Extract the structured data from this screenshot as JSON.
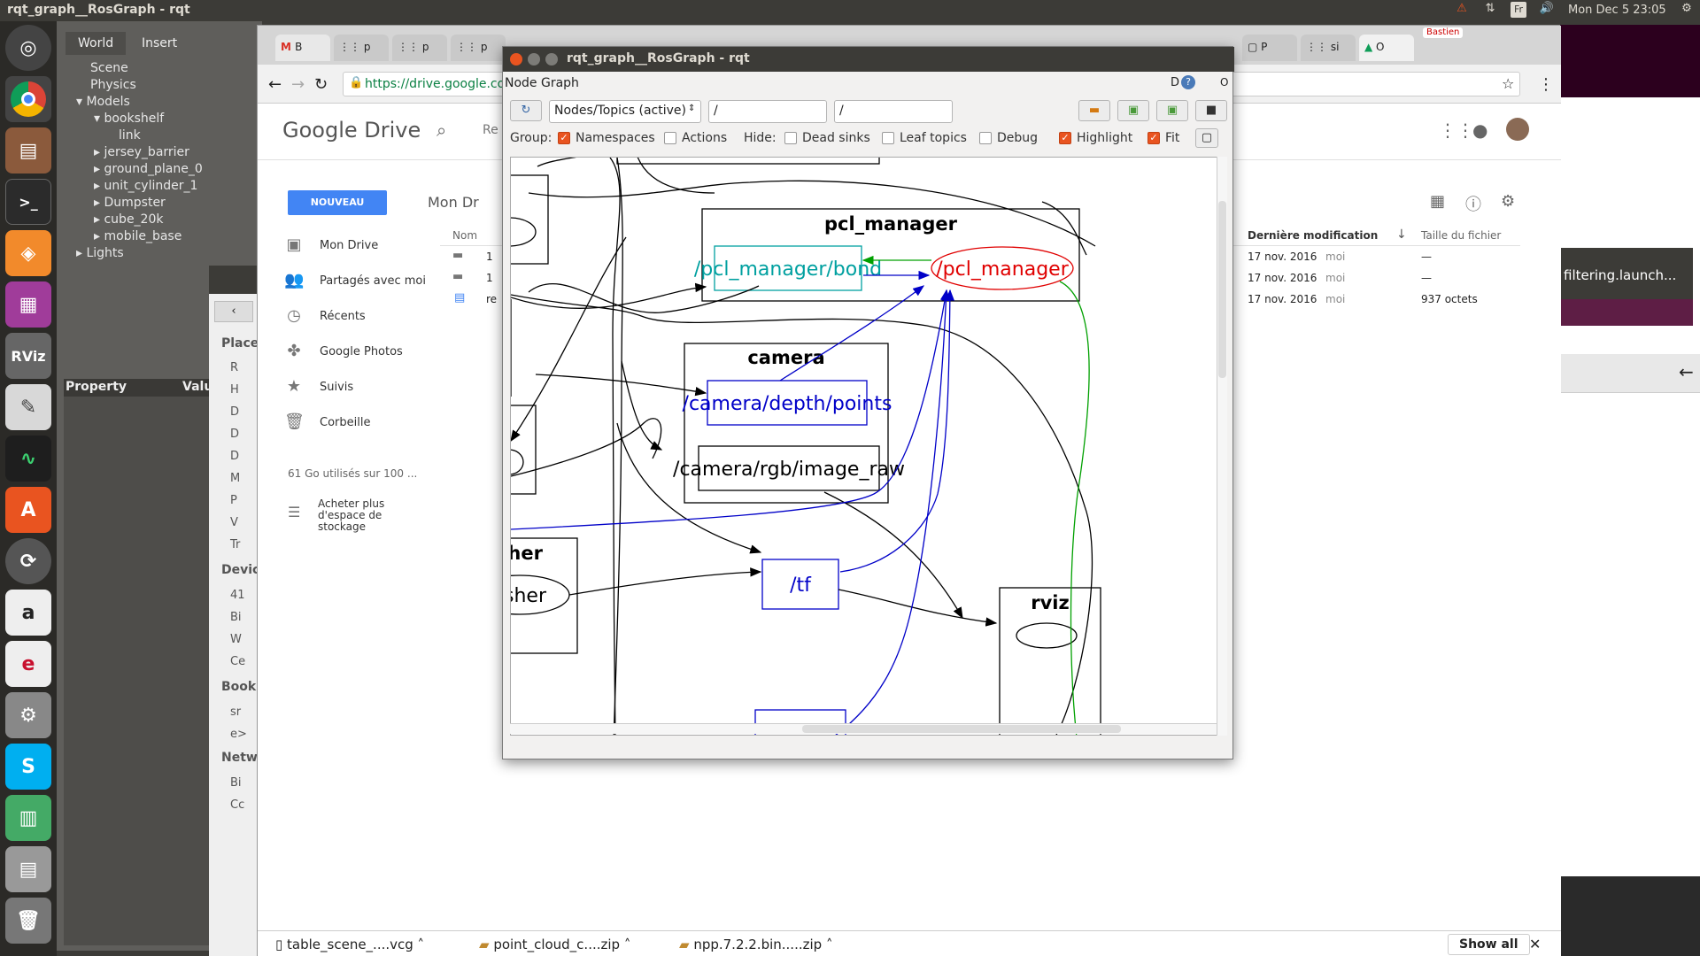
{
  "topbar": {
    "window_title": "rqt_graph__RosGraph - rqt",
    "keyboard_layout": "Fr",
    "clock": "Mon Dec  5 23:05"
  },
  "launcher": {
    "items": [
      "ubuntu-logo-icon",
      "chrome-icon",
      "files-icon",
      "terminal-icon",
      "sublime-icon",
      "rqt-icon",
      "rviz-icon",
      "text-editor-icon",
      "system-monitor-icon",
      "software-center-icon",
      "updater-icon",
      "amazon-icon",
      "app-icon",
      "settings-icon",
      "skype-icon",
      "stacked-apps-icon",
      "trash-icon"
    ],
    "rviz_label": "RViz"
  },
  "gazebo": {
    "tabs": [
      "World",
      "Insert"
    ],
    "tree": [
      {
        "label": "Scene",
        "level": 1
      },
      {
        "label": "Physics",
        "level": 1
      },
      {
        "label": "Models",
        "level": 0,
        "open": true
      },
      {
        "label": "bookshelf",
        "level": 1,
        "open": true
      },
      {
        "label": "link",
        "level": 3
      },
      {
        "label": "jersey_barrier",
        "level": 2
      },
      {
        "label": "ground_plane_0",
        "level": 2
      },
      {
        "label": "unit_cylinder_1",
        "level": 2
      },
      {
        "label": "Dumpster",
        "level": 2
      },
      {
        "label": "cube_20k",
        "level": 2
      },
      {
        "label": "mobile_base",
        "level": 2
      },
      {
        "label": "Lights",
        "level": 0
      }
    ],
    "property_header": "Property",
    "value_header": "Value"
  },
  "filemanager": {
    "section_places": "Place",
    "items_places": [
      "R",
      "H",
      "D",
      "D",
      "D",
      "M",
      "P",
      "V",
      "Tr"
    ],
    "section_devices": "Devic",
    "items_devices": [
      "41",
      "Bi",
      "W",
      "Ce"
    ],
    "section_bookmarks": "Book",
    "items_bookmarks": [
      "sr",
      "e>"
    ],
    "section_network": "Netw",
    "items_network": [
      "Bi",
      "Cc"
    ]
  },
  "chrome": {
    "tabs": [
      "B",
      "p",
      "p",
      "p",
      "",
      "",
      "",
      "",
      "",
      "",
      "",
      "",
      "",
      "",
      "",
      "P",
      "si",
      "O"
    ],
    "url": "https://drive.google.com",
    "user_label": "Bastien",
    "drive": {
      "logo": "Google Drive",
      "search_placeholder": "Re",
      "new_button": "NOUVEAU",
      "breadcrumb": "Mon Dr",
      "nav": [
        {
          "label": "Mon Drive",
          "icon": "drive-icon"
        },
        {
          "label": "Partagés avec moi",
          "icon": "people-icon"
        },
        {
          "label": "Récents",
          "icon": "clock-icon"
        },
        {
          "label": "Google Photos",
          "icon": "pinwheel-icon"
        },
        {
          "label": "Suivis",
          "icon": "star-icon"
        },
        {
          "label": "Corbeille",
          "icon": "trash-icon"
        }
      ],
      "storage": "61 Go utilisés sur 100 ...",
      "buy_storage": "Acheter plus d'espace de stockage",
      "columns": {
        "name": "Nom",
        "modified": "Dernière modification",
        "size": "Taille du fichier"
      },
      "rows": [
        {
          "name": "1",
          "modified": "17 nov. 2016",
          "owner": "moi",
          "size": "—",
          "type": "folder"
        },
        {
          "name": "1",
          "modified": "17 nov. 2016",
          "owner": "moi",
          "size": "—",
          "type": "folder"
        },
        {
          "name": "re",
          "modified": "17 nov. 2016",
          "owner": "moi",
          "size": "937 octets",
          "type": "doc"
        }
      ]
    },
    "downloads": [
      "table_scene_....vcg",
      "point_cloud_c....zip",
      "npp.7.2.2.bin.....zip"
    ],
    "show_all": "Show all"
  },
  "rightwin": {
    "tab_label": "filtering.launch..."
  },
  "rqt": {
    "title": "rqt_graph__RosGraph - rqt",
    "plugin": "Node Graph",
    "plugin_right": "D",
    "mode": "Nodes/Topics (active)",
    "filter1": "/",
    "filter2": "/",
    "group_label": "Group:",
    "namespaces": "Namespaces",
    "actions": "Actions",
    "hide_label": "Hide:",
    "dead_sinks": "Dead sinks",
    "leaf_topics": "Leaf topics",
    "debug": "Debug",
    "highlight": "Highlight",
    "fit": "Fit",
    "graph": {
      "pcl_manager_ns": "pcl_manager",
      "bond_topic": "/pcl_manager/bond",
      "pcl_manager_node": "/pcl_manager",
      "camera_ns": "camera",
      "depth_topic": "/camera/depth/points",
      "rgb_topic": "/camera/rgb/image_raw",
      "tf_topic": "/tf",
      "rviz_ns": "rviz",
      "publisher_ns": "sher",
      "publisher_node": "isher"
    }
  },
  "colors": {
    "accent_orange": "#e95420",
    "ros_topic_blue": "#0000c8",
    "bond_teal": "#00a0a0",
    "node_red": "#e00000"
  }
}
